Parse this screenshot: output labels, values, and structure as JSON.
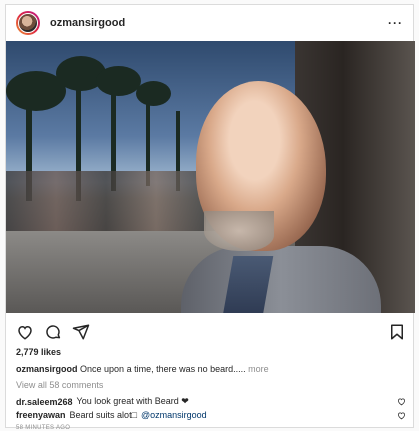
{
  "post": {
    "username": "ozmansirgood",
    "more_label": "···",
    "likes": "2,779 likes",
    "caption": {
      "username": "ozmansirgood",
      "text": "Once upon a time, there was no beard.....",
      "more": "more"
    },
    "view_all": "View all 58 comments",
    "comments": [
      {
        "username": "dr.saleem268",
        "text": "You look great with Beard ❤"
      },
      {
        "username": "freenyawan",
        "text": "Beard suits alot□",
        "mention": "@ozmansirgood"
      }
    ],
    "time": "58 MINUTES AGO"
  },
  "icons": [
    "heart-icon",
    "comment-icon",
    "share-icon",
    "bookmark-icon"
  ],
  "colors": {
    "border": "#dbdbdb",
    "text": "#262626",
    "muted": "#8e8e8e",
    "mention": "#00376b"
  }
}
